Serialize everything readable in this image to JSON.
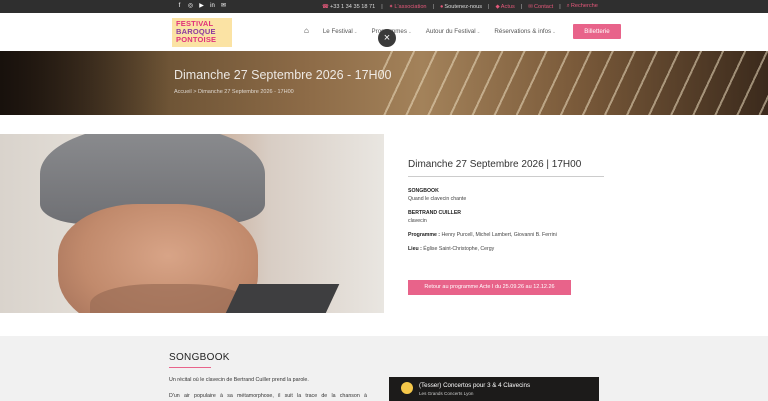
{
  "topbar": {
    "social": [
      "f",
      "◎",
      "▶",
      "in",
      "✉"
    ],
    "phone": "+33 1 34 35 18 71",
    "links": [
      {
        "label": "L'association"
      },
      {
        "label": "Soutenez-nous"
      },
      {
        "label": "Actus"
      },
      {
        "label": "Contact"
      },
      {
        "label": "Recherche"
      }
    ]
  },
  "header": {
    "logo_line1": "FESTIVAL",
    "logo_line2": "BAROQUE",
    "logo_line3": "PONTOISE",
    "nav": [
      {
        "label": "Le Festival"
      },
      {
        "label": "Programmes"
      },
      {
        "label": "Autour du Festival"
      },
      {
        "label": "Réservations & infos"
      }
    ],
    "billetterie": "Billetterie",
    "close": "×"
  },
  "banner": {
    "title": "Dimanche 27 Septembre 2026 - 17H00",
    "breadcrumb": "Accueil  >  Dimanche 27 Septembre 2026 - 17H00"
  },
  "event": {
    "title": "Dimanche 27 Septembre 2026 | 17H00",
    "show_name": "SONGBOOK",
    "show_subtitle": "Quand le clavecin chante",
    "artist": "BERTRAND CUILLER",
    "instrument": "clavecin",
    "programme_label": "Programme :",
    "programme": " Henry Purcell, Michel Lambert, Giovanni B. Ferrini",
    "lieu_label": "Lieu :",
    "lieu": " Église Saint-Christophe, Cergy",
    "retour_button": "Retour au programme Acte I du 25.09.26 au 12.12.26"
  },
  "description": {
    "heading": "SONGBOOK",
    "p1": "Un récital où le clavecin de Bertrand Cuiller prend la parole.",
    "p2_words": [
      "D'un",
      "air",
      "populaire",
      "à",
      "sa",
      "métamorphose,",
      "il",
      "suit",
      "la",
      "trace",
      "de",
      "la",
      "chanson",
      "à"
    ]
  },
  "video": {
    "title": "(Tesser) Concertos pour 3 & 4 Clavecins",
    "channel": "Les Grands Concerts Lyon"
  },
  "colors": {
    "accent": "#e8638a",
    "topbar": "#2f2f2f"
  }
}
